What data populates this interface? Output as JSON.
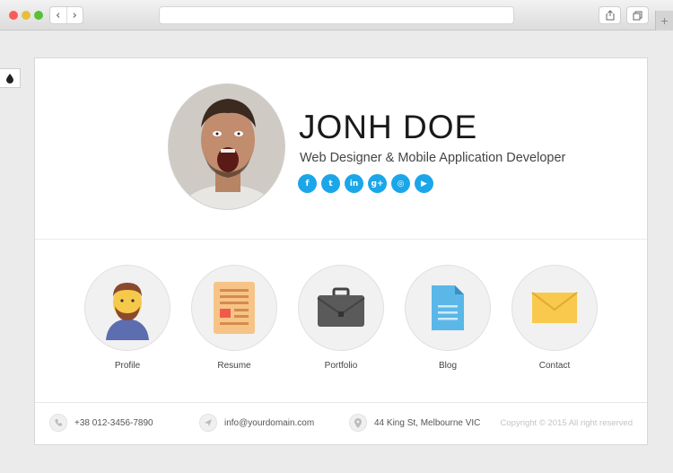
{
  "profile": {
    "name": "JONH DOE",
    "title": "Web Designer & Mobile Application Developer"
  },
  "social_links": [
    {
      "icon": "facebook-icon",
      "glyph": "f"
    },
    {
      "icon": "twitter-icon",
      "glyph": "t"
    },
    {
      "icon": "linkedin-icon",
      "glyph": "in"
    },
    {
      "icon": "google-plus-icon",
      "glyph": "g+"
    },
    {
      "icon": "dribbble-icon",
      "glyph": "◎"
    },
    {
      "icon": "youtube-icon",
      "glyph": "▶"
    }
  ],
  "menu": {
    "items": [
      {
        "label": "Profile",
        "icon": "person-avatar-icon"
      },
      {
        "label": "Resume",
        "icon": "document-icon"
      },
      {
        "label": "Portfolio",
        "icon": "briefcase-icon"
      },
      {
        "label": "Blog",
        "icon": "file-icon"
      },
      {
        "label": "Contact",
        "icon": "envelope-icon"
      }
    ]
  },
  "footer": {
    "phone": "+38 012-3456-7890",
    "email": "info@yourdomain.com",
    "address": "44 King St, Melbourne VIC",
    "copyright": "Copyright © 2015 All right reserved"
  },
  "colors": {
    "accent": "#1ba6e9"
  }
}
